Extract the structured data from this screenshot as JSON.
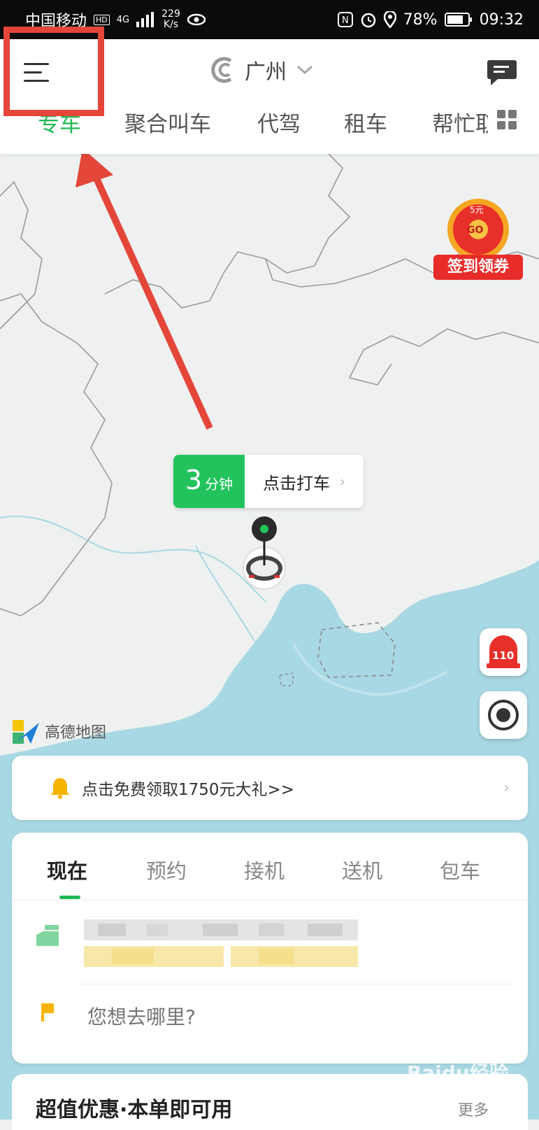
{
  "status_bar": {
    "carrier": "中国移动",
    "hd": "HD",
    "network": "4G",
    "speed_value": "229",
    "speed_unit": "K/s",
    "battery": "78%",
    "time": "09:32"
  },
  "header": {
    "city": "广州",
    "tabs": [
      "专车",
      "聚合叫车",
      "代驾",
      "租车",
      "帮忙取"
    ]
  },
  "map": {
    "signin_badge": {
      "top": "5元",
      "center": "GO",
      "label": "签到领券"
    },
    "eta": {
      "minutes": "3",
      "unit": "分钟",
      "action": "点击打车"
    },
    "emergency_label": "110",
    "provider": "高德地图"
  },
  "promo": {
    "text": "点击免费领取1750元大礼>>"
  },
  "booking": {
    "tabs": [
      "现在",
      "预约",
      "接机",
      "送机",
      "包车"
    ],
    "destination_placeholder": "您想去哪里?"
  },
  "deals": {
    "title": "超值优惠·本单即可用",
    "more": "更多"
  },
  "watermark": "Baidu经验",
  "colors": {
    "accent_green": "#1fb954",
    "annotation_red": "#e4463a",
    "map_water": "#a8d8e3",
    "map_land": "#eef1f0"
  }
}
